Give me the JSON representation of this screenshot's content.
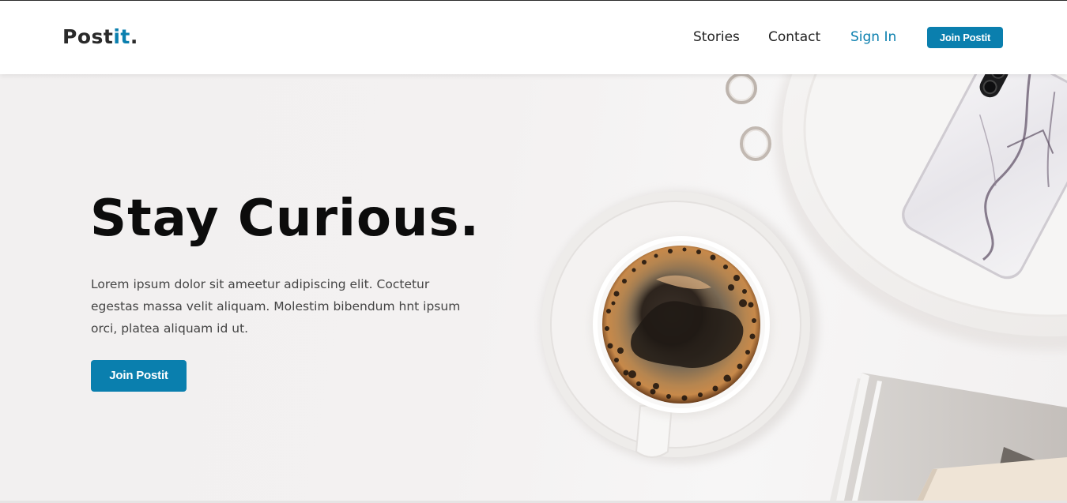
{
  "header": {
    "logo": {
      "text_main": "Post",
      "text_accent": "it",
      "text_dot": "."
    },
    "nav": {
      "stories": "Stories",
      "contact": "Contact",
      "sign_in": "Sign In",
      "join_button": "Join Postit"
    }
  },
  "hero": {
    "title": "Stay Curious.",
    "description": "Lorem ipsum dolor sit ameetur adipiscing elit. Coctetur egestas massa velit aliquam. Molestim bibendum hnt ipsum orci, platea aliquam id ut.",
    "cta_button": "Join Postit",
    "image_subjects": [
      "coffee-cup",
      "saucer",
      "rings",
      "plate",
      "phone",
      "notebooks"
    ]
  },
  "colors": {
    "accent": "#0a7fae",
    "text_dark": "#0c0c0c",
    "text_body": "#444444",
    "header_bg": "#ffffff",
    "hero_bg": "#f2f0f0"
  }
}
